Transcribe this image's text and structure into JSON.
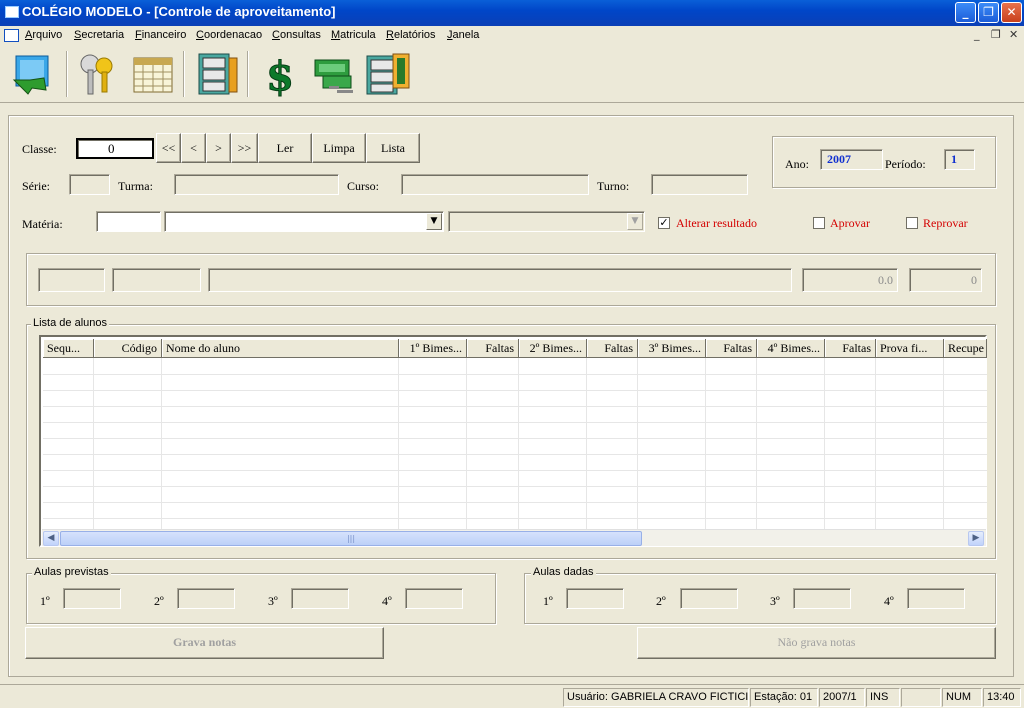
{
  "window": {
    "title": "COLÉGIO MODELO - [Controle de aproveitamento]"
  },
  "menu": [
    "Arquivo",
    "Secretaria",
    "Financeiro",
    "Coordenacao",
    "Consultas",
    "Matricula",
    "Relatórios",
    "Janela"
  ],
  "form": {
    "classe_label": "Classe:",
    "classe_value": "0",
    "nav": {
      "first": "<<",
      "prev": "<",
      "next": ">",
      "last": ">>"
    },
    "ler": "Ler",
    "limpa": "Limpa",
    "lista": "Lista",
    "ano_label": "Ano:",
    "ano_value": "2007",
    "periodo_label": "Período:",
    "periodo_value": "1",
    "serie_label": "Série:",
    "turma_label": "Turma:",
    "curso_label": "Curso:",
    "turno_label": "Turno:",
    "materia_label": "Matéria:",
    "alterar_label": "Alterar resultado",
    "aprovar_label": "Aprovar",
    "reprovar_label": "Reprovar",
    "nota_value": "0.0",
    "count_value": "0"
  },
  "grid": {
    "title": "Lista de alunos",
    "columns": [
      "Sequ...",
      "Código",
      "Nome do aluno",
      "1º Bimes...",
      "Faltas",
      "2º Bimes...",
      "Faltas",
      "3º Bimes...",
      "Faltas",
      "4º Bimes...",
      "Faltas",
      "Prova fi...",
      "Recupe"
    ]
  },
  "aulas_previstas": {
    "title": "Aulas previstas",
    "labels": [
      "1º",
      "2º",
      "3º",
      "4º"
    ]
  },
  "aulas_dadas": {
    "title": "Aulas dadas",
    "labels": [
      "1º",
      "2º",
      "3º",
      "4º"
    ]
  },
  "buttons": {
    "grava": "Grava notas",
    "nao_grava": "Não grava notas"
  },
  "status": {
    "usuario": "Usuário: GABRIELA CRAVO FICTICIO",
    "estacao": "Estação: 01",
    "periodo": "2007/1",
    "ins": "INS",
    "num": "NUM",
    "time": "13:40"
  },
  "colors": {
    "title_bar": "#0046c8",
    "face": "#ece9d8",
    "accent_red": "#d40000",
    "accent_blue": "#1030d0"
  }
}
